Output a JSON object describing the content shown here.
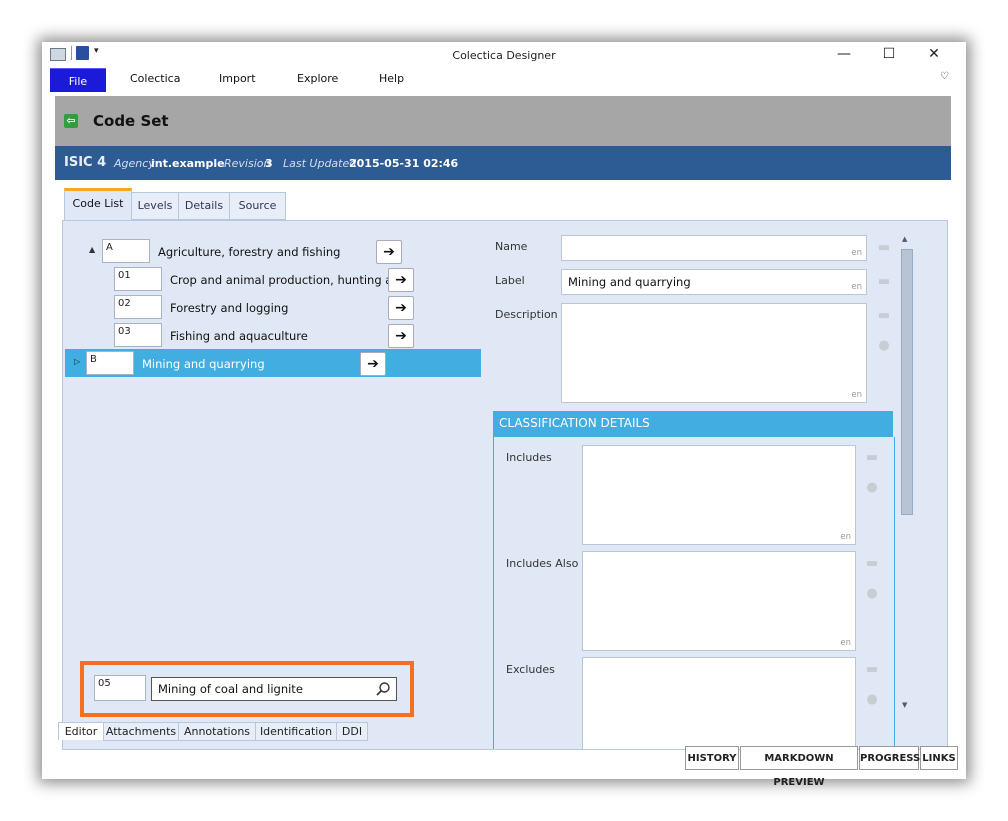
{
  "app": {
    "title": "Colectica Designer"
  },
  "menu": {
    "file": "File",
    "items": [
      "Colectica",
      "Import",
      "Explore",
      "Help"
    ]
  },
  "window_controls": {
    "minimize": "—",
    "maximize": "☐",
    "close": "✕"
  },
  "header": {
    "title": "Code Set",
    "back_icon": "back-arrow-icon"
  },
  "info": {
    "name": "ISIC 4",
    "agency_label": "Agency",
    "agency_value": "int.example",
    "revision_label": "Revision",
    "revision_value": "3",
    "updated_label": "Last Updated",
    "updated_value": "2015-05-31 02:46"
  },
  "tabs": [
    "Code List",
    "Levels",
    "Details",
    "Source"
  ],
  "code_list": [
    {
      "code": "A",
      "label": "Agriculture, forestry and fishing",
      "level": 0,
      "expander": "▲"
    },
    {
      "code": "01",
      "label": "Crop and animal production, hunting and",
      "level": 1
    },
    {
      "code": "02",
      "label": "Forestry and logging",
      "level": 1
    },
    {
      "code": "03",
      "label": "Fishing and aquaculture",
      "level": 1
    },
    {
      "code": "B",
      "label": "Mining and quarrying",
      "level": 0,
      "expander": "▷",
      "selected": true
    }
  ],
  "arrow_symbol": "➔",
  "new_item": {
    "code": "05",
    "value": "Mining of coal and lignite"
  },
  "form": {
    "name_label": "Name",
    "name_value": "",
    "label_label": "Label",
    "label_value": "Mining and quarrying",
    "description_label": "Description",
    "description_value": "",
    "lang": "en"
  },
  "classification": {
    "header": "CLASSIFICATION DETAILS",
    "includes": "Includes",
    "includes_also": "Includes Also",
    "excludes": "Excludes"
  },
  "bottom_tabs": [
    "Editor",
    "Attachments",
    "Annotations",
    "Identification",
    "DDI"
  ],
  "actions": [
    "HISTORY",
    "MARKDOWN PREVIEW",
    "PROGRESS",
    "LINKS"
  ],
  "colors": {
    "selection": "#41ade1",
    "info_bar": "#2d5b93",
    "highlight": "#f37021",
    "file_menu": "#1a1ad8"
  }
}
